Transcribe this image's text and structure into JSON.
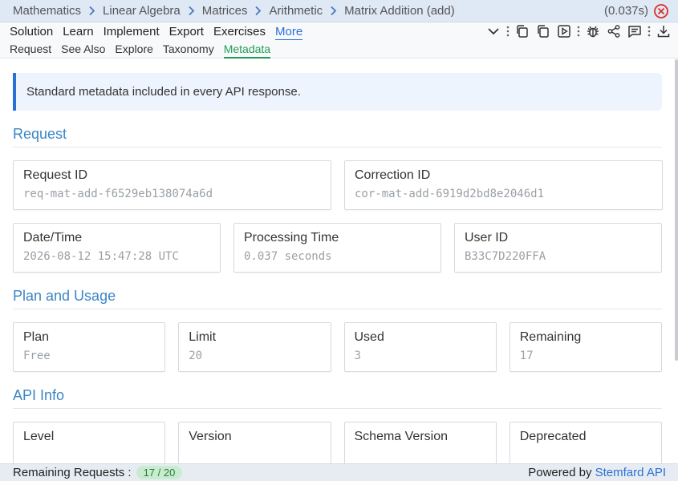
{
  "breadcrumb": [
    "Mathematics",
    "Linear Algebra",
    "Matrices",
    "Arithmetic",
    "Matrix Addition (add)"
  ],
  "timing": "(0.037s)",
  "menu": {
    "items": [
      "Solution",
      "Learn",
      "Implement",
      "Export",
      "Exercises",
      "More"
    ],
    "active": "More"
  },
  "toolbar_icons": [
    "chevron-down-icon",
    "kebab-icon",
    "copy-icon",
    "copy-alt-icon",
    "play-icon",
    "kebab-icon",
    "bug-icon",
    "share-icon",
    "comment-icon",
    "kebab-icon",
    "download-icon"
  ],
  "subtabs": {
    "items": [
      "Request",
      "See Also",
      "Explore",
      "Taxonomy",
      "Metadata"
    ],
    "active": "Metadata"
  },
  "notice": "Standard metadata included in every API response.",
  "sections": {
    "request": {
      "title": "Request",
      "row1": [
        {
          "label": "Request ID",
          "value": "req-mat-add-f6529eb138074a6d"
        },
        {
          "label": "Correction ID",
          "value": "cor-mat-add-6919d2bd8e2046d1"
        }
      ],
      "row2": [
        {
          "label": "Date/Time",
          "value": "2026-08-12 15:47:28 UTC"
        },
        {
          "label": "Processing Time",
          "value": "0.037 seconds"
        },
        {
          "label": "User ID",
          "value": "B33C7D220FFA"
        }
      ]
    },
    "plan": {
      "title": "Plan and Usage",
      "cards": [
        {
          "label": "Plan",
          "value": "Free"
        },
        {
          "label": "Limit",
          "value": "20"
        },
        {
          "label": "Used",
          "value": "3"
        },
        {
          "label": "Remaining",
          "value": "17"
        }
      ]
    },
    "api": {
      "title": "API Info",
      "cards": [
        {
          "label": "Level",
          "value": ""
        },
        {
          "label": "Version",
          "value": ""
        },
        {
          "label": "Schema Version",
          "value": ""
        },
        {
          "label": "Deprecated",
          "value": ""
        }
      ]
    }
  },
  "footer": {
    "remaining_label": "Remaining Requests :",
    "remaining_value": "17 / 20",
    "powered_prefix": "Powered by",
    "powered_link": "Stemfard API"
  },
  "colors": {
    "accent": "#2a6fd6",
    "active_subtab": "#1f9d55",
    "section_title": "#3b86c7",
    "close": "#d93025",
    "badge_bg": "#c8ecd0"
  }
}
